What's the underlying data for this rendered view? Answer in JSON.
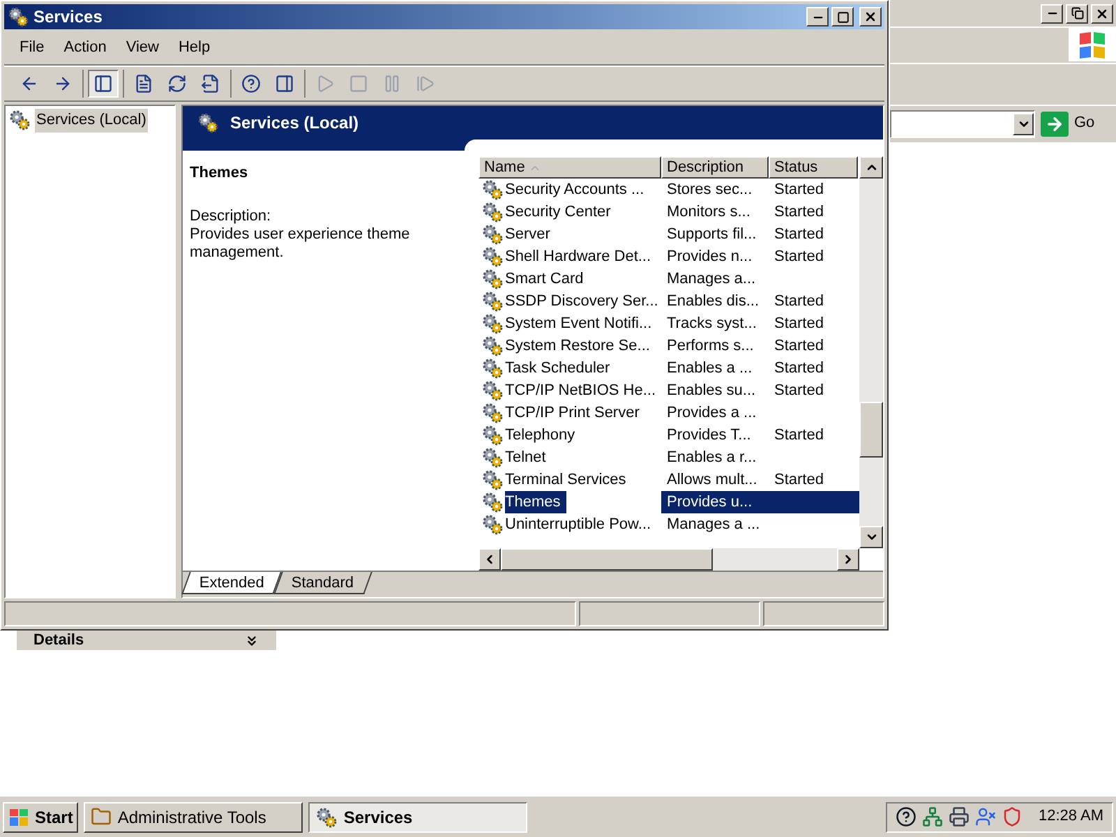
{
  "background_window": {
    "go_button": "Go",
    "details_panel": {
      "title": "Details",
      "expanded": false
    }
  },
  "window": {
    "title": "Services"
  },
  "menu": [
    "File",
    "Action",
    "View",
    "Help"
  ],
  "toolbar": [
    [
      {
        "kind": "back",
        "disabled": false,
        "pressed": false
      },
      {
        "kind": "forward",
        "disabled": false,
        "pressed": false
      }
    ],
    [
      {
        "kind": "console_tree",
        "disabled": false,
        "pressed": true
      }
    ],
    [
      {
        "kind": "properties",
        "disabled": false,
        "pressed": false
      },
      {
        "kind": "refresh",
        "disabled": false,
        "pressed": false
      },
      {
        "kind": "export",
        "disabled": false,
        "pressed": false
      }
    ],
    [
      {
        "kind": "help",
        "disabled": false,
        "pressed": false
      },
      {
        "kind": "action_pane",
        "disabled": false,
        "pressed": false
      }
    ],
    [
      {
        "kind": "start",
        "disabled": true,
        "pressed": false
      },
      {
        "kind": "stop",
        "disabled": true,
        "pressed": false
      },
      {
        "kind": "pause",
        "disabled": true,
        "pressed": false
      },
      {
        "kind": "restart",
        "disabled": true,
        "pressed": false
      }
    ]
  ],
  "tree": [
    {
      "label": "Services (Local)",
      "selected": true
    }
  ],
  "pane_header": "Services (Local)",
  "details": {
    "title": "Themes",
    "description_label": "Description:",
    "description": "Provides user experience theme management."
  },
  "table": {
    "columns": [
      {
        "label": "Name",
        "sorted": true
      },
      {
        "label": "Description",
        "sorted": false
      },
      {
        "label": "Status",
        "sorted": false
      }
    ],
    "rows": [
      {
        "name": "Security Accounts ...",
        "description": "Stores sec...",
        "status": "Started",
        "selected": false
      },
      {
        "name": "Security Center",
        "description": "Monitors s...",
        "status": "Started",
        "selected": false
      },
      {
        "name": "Server",
        "description": "Supports fil...",
        "status": "Started",
        "selected": false
      },
      {
        "name": "Shell Hardware Det...",
        "description": "Provides n...",
        "status": "Started",
        "selected": false
      },
      {
        "name": "Smart Card",
        "description": "Manages a...",
        "status": "",
        "selected": false
      },
      {
        "name": "SSDP Discovery Ser...",
        "description": "Enables dis...",
        "status": "Started",
        "selected": false
      },
      {
        "name": "System Event Notifi...",
        "description": "Tracks syst...",
        "status": "Started",
        "selected": false
      },
      {
        "name": "System Restore Se...",
        "description": "Performs s...",
        "status": "Started",
        "selected": false
      },
      {
        "name": "Task Scheduler",
        "description": "Enables a ...",
        "status": "Started",
        "selected": false
      },
      {
        "name": "TCP/IP NetBIOS He...",
        "description": "Enables su...",
        "status": "Started",
        "selected": false
      },
      {
        "name": "TCP/IP Print Server",
        "description": "Provides a ...",
        "status": "",
        "selected": false
      },
      {
        "name": "Telephony",
        "description": "Provides T...",
        "status": "Started",
        "selected": false
      },
      {
        "name": "Telnet",
        "description": "Enables a r...",
        "status": "",
        "selected": false
      },
      {
        "name": "Terminal Services",
        "description": "Allows mult...",
        "status": "Started",
        "selected": false
      },
      {
        "name": "Themes",
        "description": "Provides u...",
        "status": "",
        "selected": true
      },
      {
        "name": "Uninterruptible Pow...",
        "description": "Manages a ...",
        "status": "",
        "selected": false
      }
    ]
  },
  "tabs": [
    {
      "label": "Extended",
      "selected": true
    },
    {
      "label": "Standard",
      "selected": false
    }
  ],
  "taskbar": {
    "start": "Start",
    "tasks": [
      {
        "label": "Administrative Tools",
        "kind": "folder",
        "selected": false
      },
      {
        "label": "Services",
        "kind": "services",
        "selected": true
      }
    ],
    "tray": [
      {
        "kind": "help"
      },
      {
        "kind": "network"
      },
      {
        "kind": "printer"
      },
      {
        "kind": "user"
      },
      {
        "kind": "shield"
      }
    ],
    "clock": "12:28 AM"
  }
}
